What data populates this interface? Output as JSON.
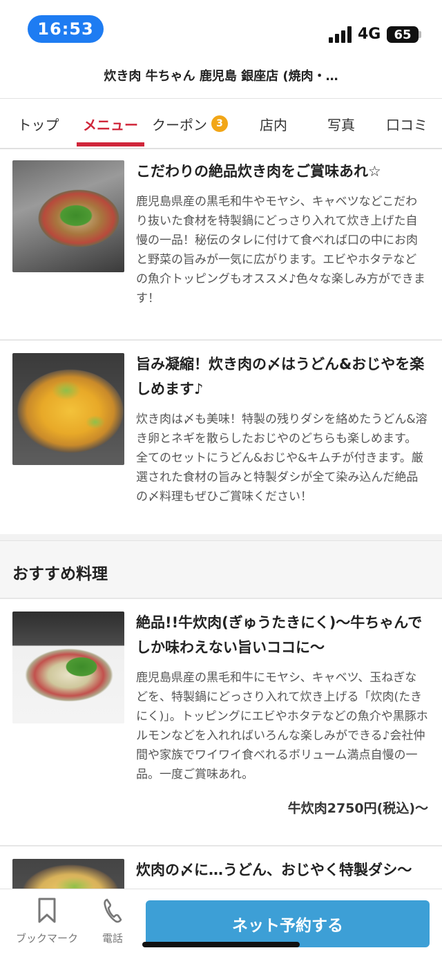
{
  "status_bar": {
    "time": "16:53",
    "network": "4G",
    "battery": "65"
  },
  "header": {
    "title": "炊き肉 牛ちゃん 鹿児島 銀座店 (焼肉・…"
  },
  "tabs": [
    {
      "label": "トップ"
    },
    {
      "label": "メニュー"
    },
    {
      "label": "クーポン",
      "badge": "3"
    },
    {
      "label": "店内"
    },
    {
      "label": "写真"
    },
    {
      "label": "口コミ"
    }
  ],
  "colors": {
    "accent_red": "#d0263a",
    "reserve_blue": "#3d9fd6",
    "badge_orange": "#f2a617",
    "time_pill_blue": "#1e7cf2"
  },
  "items_top": [
    {
      "title": "こだわりの絶品炊き肉をご賞味あれ☆",
      "description": "鹿児島県産の黒毛和牛やモヤシ、キャベツなどこだわり抜いた食材を特製鍋にどっさり入れて炊き上げた自慢の一品！秘伝のタレに付けて食べれば口の中にお肉と野菜の旨みが一気に広がります。エビやホタテなどの魚介トッピングもオススメ♪色々な楽しみ方ができます！"
    },
    {
      "title": "旨み凝縮！炊き肉の〆はうどん&おじやを楽しめます♪",
      "description": "炊き肉は〆も美味！特製の残りダシを絡めたうどん&溶き卵とネギを散らしたおじやのどちらも楽しめます。全てのセットにうどん&おじや&キムチが付きます。厳選された食材の旨みと特製ダシが全て染み込んだ絶品の〆料理もぜひご賞味ください！"
    }
  ],
  "recommended": {
    "heading": "おすすめ料理",
    "items": [
      {
        "title": "絶品!!牛炊肉(ぎゅうたきにく)〜牛ちゃんでしか味わえない旨いココに〜",
        "description": "鹿児島県産の黒毛和牛にモヤシ、キャベツ、玉ねぎなどを、特製鍋にどっさり入れて炊き上げる「炊肉(たきにく)」。トッピングにエビやホタテなどの魚介や黒豚ホルモンなどを入れればいろんな楽しみができる♪会社仲間や家族でワイワイ食べれるボリューム満点自慢の一品。一度ご賞味あれ。",
        "price": "牛炊肉2750円(税込)〜"
      },
      {
        "title": "炊肉の〆に…うどん、おじやく特製ダシ〜"
      }
    ]
  },
  "bottom_bar": {
    "bookmark_label": "ブックマーク",
    "phone_label": "電話",
    "reserve_label": "ネット予約する"
  }
}
